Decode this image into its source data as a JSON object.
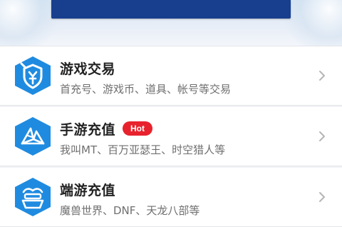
{
  "menu": {
    "items": [
      {
        "title": "游戏交易",
        "subtitle": "首充号、游戏币、道具、帐号等交易",
        "icon": "trade-icon"
      },
      {
        "title": "手游充值",
        "badge": "Hot",
        "subtitle": "我叫MT、百万亚瑟王、时空猎人等",
        "icon": "mobile-game-icon"
      },
      {
        "title": "端游充值",
        "subtitle": "魔兽世界、DNF、天龙八部等",
        "icon": "pc-game-icon"
      }
    ]
  },
  "colors": {
    "icon_blue": "#1f8be0",
    "badge_red": "#e8222d",
    "banner_blue": "#173f8e"
  }
}
